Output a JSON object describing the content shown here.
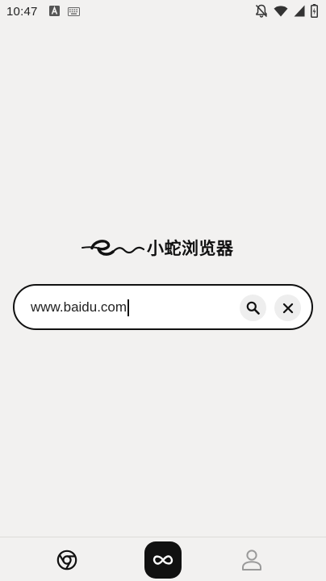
{
  "status_bar": {
    "time": "10:47",
    "left_icons": [
      "android-a-icon",
      "keyboard-icon"
    ],
    "right_icons": [
      "notifications-off-icon",
      "wifi-icon",
      "signal-icon",
      "battery-icon"
    ]
  },
  "logo": {
    "text": "小蛇浏览器",
    "icon": "snake-logo-icon"
  },
  "search": {
    "value": "www.baidu.com",
    "search_icon": "search-icon",
    "clear_icon": "close-icon"
  },
  "bottom_nav": {
    "items": [
      "browser-icon",
      "infinity-icon",
      "profile-icon"
    ]
  },
  "colors": {
    "background": "#f2f1f0",
    "accent": "#111111",
    "input_background": "#ffffff",
    "button_background": "#eeeeee"
  }
}
